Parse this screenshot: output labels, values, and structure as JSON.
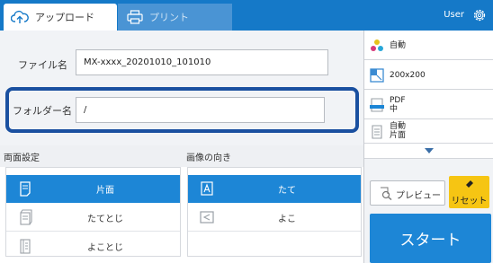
{
  "header": {
    "tabs": [
      {
        "label": "アップロード",
        "icon": "cloud-upload-icon",
        "active": true
      },
      {
        "label": "プリント",
        "icon": "printer-icon",
        "active": false
      }
    ],
    "user_label": "User",
    "settings_icon": "gear-icon",
    "accent_color": "#1579c8"
  },
  "form": {
    "file_name_label": "ファイル名",
    "file_name_value": "MX-xxxx_20201010_101010",
    "folder_name_label": "フォルダー名",
    "folder_name_value": "/"
  },
  "duplex": {
    "title": "両面設定",
    "options": [
      {
        "label": "片面",
        "icon": "single-sided-icon",
        "selected": true
      },
      {
        "label": "たてとじ",
        "icon": "long-edge-binding-icon",
        "selected": false
      },
      {
        "label": "よことじ",
        "icon": "short-edge-binding-icon",
        "selected": false
      }
    ]
  },
  "orientation": {
    "title": "画像の向き",
    "options": [
      {
        "label": "たて",
        "icon": "portrait-icon",
        "selected": true
      },
      {
        "label": "よこ",
        "icon": "landscape-icon",
        "selected": false
      }
    ]
  },
  "side_settings": {
    "items": [
      {
        "lines": [
          "自動"
        ],
        "icon": "color-mode-icon"
      },
      {
        "lines": [
          "200x200"
        ],
        "icon": "resolution-icon"
      },
      {
        "lines": [
          "PDF",
          "中"
        ],
        "icon": "file-format-icon"
      },
      {
        "lines": [
          "自動",
          "片面"
        ],
        "icon": "original-size-icon"
      }
    ],
    "more_icon": "chevron-down-icon"
  },
  "actions": {
    "preview_label": "プレビュー",
    "reset_label": "リセット",
    "start_label": "スタート",
    "start_color": "#1d86d6",
    "reset_color": "#f6c513"
  }
}
